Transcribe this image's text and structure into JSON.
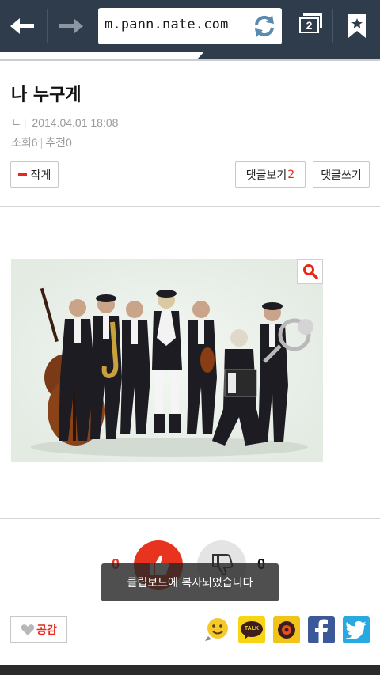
{
  "browser": {
    "url": "m.pann.nate.com",
    "tab_count": "2",
    "icons": [
      "back-arrow-icon",
      "forward-arrow-icon",
      "reload-icon",
      "tabs-icon",
      "bookmark-icon"
    ]
  },
  "post": {
    "title": "나 누구게",
    "author": "ㄴ",
    "date": "2014.04.01 18:08",
    "views_label": "조회",
    "views": "6",
    "likes_label": "추천",
    "likes": "0"
  },
  "actions": {
    "author_button": "작게",
    "comments_label": "댓글보기",
    "comments_count": "2",
    "write_comment": "댓글쓰기"
  },
  "votes": {
    "up_count": "0",
    "down_count": "0"
  },
  "toast": {
    "message": "클립보드에 복사되었습니다"
  },
  "share": {
    "like_label": "공감",
    "kakaotalk_label": "TALK",
    "colors": {
      "accent": "#e8281b",
      "toolbar": "#2e3c4c",
      "kakaotalk": "#f7d516",
      "facebook": "#3b5998",
      "twitter": "#29a9e1"
    }
  }
}
